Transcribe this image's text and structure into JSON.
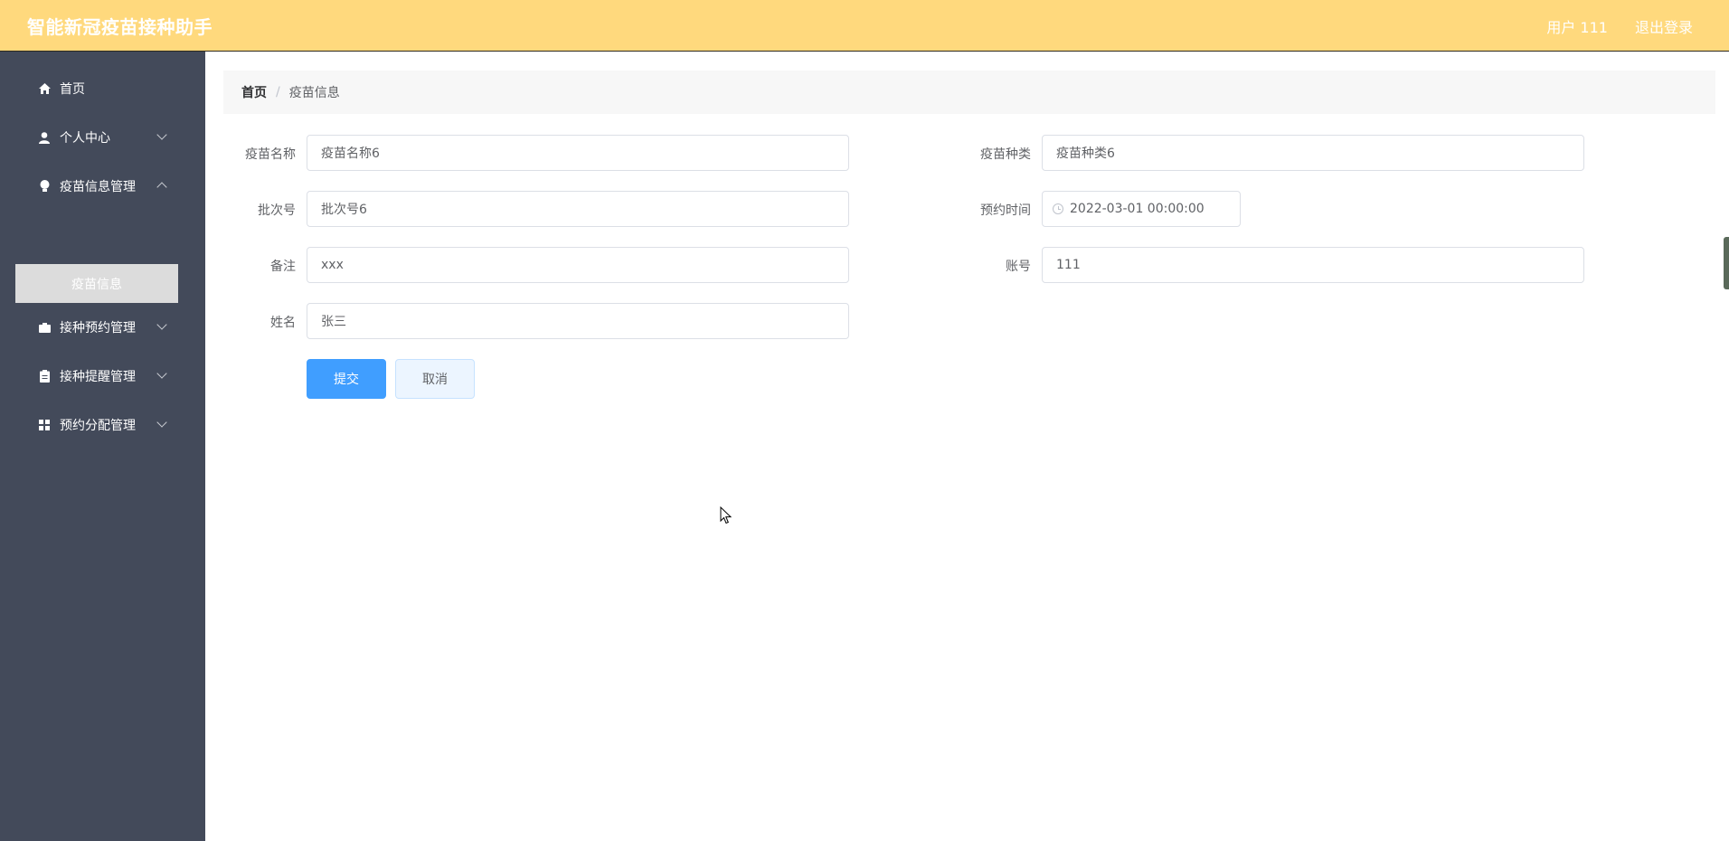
{
  "header": {
    "title": "智能新冠疫苗接种助手",
    "user": "用户 111",
    "logout": "退出登录"
  },
  "sidebar": {
    "items": [
      {
        "label": "首页",
        "icon": "home-icon"
      },
      {
        "label": "个人中心",
        "icon": "user-icon"
      },
      {
        "label": "疫苗信息管理",
        "icon": "lightbulb-icon"
      },
      {
        "label": "接种预约管理",
        "icon": "briefcase-icon"
      },
      {
        "label": "接种提醒管理",
        "icon": "clipboard-icon"
      },
      {
        "label": "预约分配管理",
        "icon": "grid-icon"
      }
    ],
    "submenu": {
      "label": "疫苗信息"
    }
  },
  "breadcrumb": {
    "home": "首页",
    "separator": "/",
    "current": "疫苗信息"
  },
  "form": {
    "vaccine_name": {
      "label": "疫苗名称",
      "value": "疫苗名称6"
    },
    "vaccine_type": {
      "label": "疫苗种类",
      "value": "疫苗种类6"
    },
    "batch_no": {
      "label": "批次号",
      "value": "批次号6"
    },
    "appointment_time": {
      "label": "预约时间",
      "value": "2022-03-01 00:00:00"
    },
    "remark": {
      "label": "备注",
      "value": "xxx"
    },
    "account": {
      "label": "账号",
      "value": "111"
    },
    "name": {
      "label": "姓名",
      "value": "张三"
    }
  },
  "buttons": {
    "submit": "提交",
    "cancel": "取消"
  }
}
